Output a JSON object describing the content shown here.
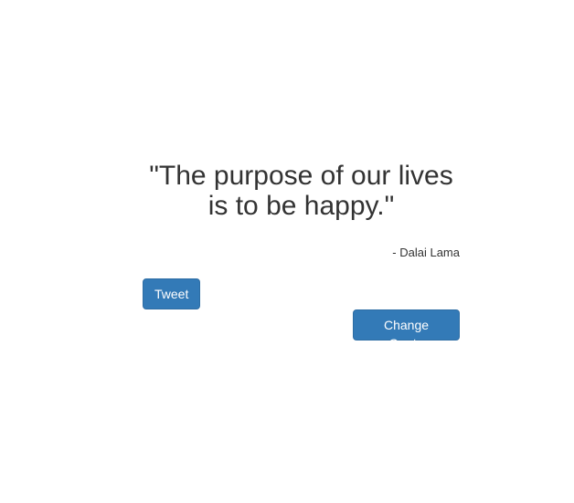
{
  "quote": {
    "text": "\"The purpose of our lives is to be happy.\"",
    "author": "- Dalai Lama"
  },
  "buttons": {
    "tweet_label": "Tweet",
    "change_quote_label": "Change Quote"
  },
  "colors": {
    "button_bg": "#337ab7",
    "button_text": "#ffffff",
    "text": "#333333"
  }
}
